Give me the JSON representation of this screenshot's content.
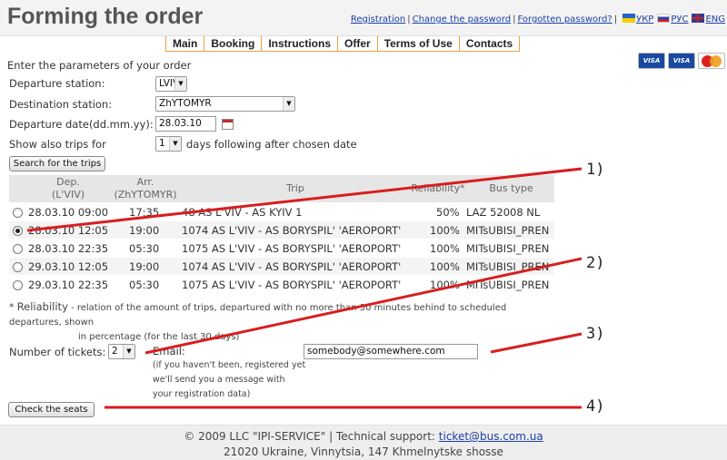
{
  "header": {
    "title": "Forming the order",
    "links": {
      "registration": "Registration",
      "change_password": "Change the password",
      "forgotten_password": "Forgotten password?",
      "sep": "|",
      "lang_ua": "УКР",
      "lang_ru": "РУС",
      "lang_en": "ENG"
    }
  },
  "nav": [
    "Main",
    "Booking",
    "Instructions",
    "Offer",
    "Terms of Use",
    "Contacts"
  ],
  "cards": {
    "visa": "VISA",
    "electron": "VISA",
    "mc": "MasterCard"
  },
  "form": {
    "heading": "Enter the parameters of your order",
    "departure_label": "Departure station:",
    "departure_value": "LVIV",
    "destination_label": "Destination station:",
    "destination_value": "ZhYTOMYR",
    "date_label": "Departure date(dd.mm.yy):",
    "date_value": "28.03.10",
    "show_label": "Show also trips for",
    "days_value": "1",
    "days_suffix": "days following after chosen date",
    "search_button": "Search for the trips"
  },
  "table": {
    "headers": {
      "dep": "Dep.",
      "dep_sub": "(L'VIV)",
      "arr": "Arr.",
      "arr_sub": "(ZhYTOMYR)",
      "trip": "Trip",
      "reliability": "Reliability*",
      "bus": "Bus type"
    },
    "rows": [
      {
        "dep": "28.03.10 09:00",
        "arr": "17:35",
        "trip": "48 AS L'VIV - AS KYIV 1",
        "rel": "50%",
        "bus": "LAZ 52008 NL",
        "selected": false
      },
      {
        "dep": "28.03.10 12:05",
        "arr": "19:00",
        "trip": "1074 AS L'VIV - AS BORYSPIL' 'AEROPORT'",
        "rel": "100%",
        "bus": "MITsUBISI_PREN",
        "selected": true
      },
      {
        "dep": "28.03.10 22:35",
        "arr": "05:30",
        "trip": "1075 AS L'VIV - AS BORYSPIL' 'AEROPORT'",
        "rel": "100%",
        "bus": "MITsUBISI_PREN",
        "selected": false
      },
      {
        "dep": "29.03.10 12:05",
        "arr": "19:00",
        "trip": "1074 AS L'VIV - AS BORYSPIL' 'AEROPORT'",
        "rel": "100%",
        "bus": "MITsUBISI_PREN",
        "selected": false
      },
      {
        "dep": "29.03.10 22:35",
        "arr": "05:30",
        "trip": "1075 AS L'VIV - AS BORYSPIL' 'AEROPORT'",
        "rel": "100%",
        "bus": "MITsUBISI_PREN",
        "selected": false
      }
    ]
  },
  "note": {
    "star": "*",
    "label": "Reliability",
    "text": "- relation of the amount of trips, departured with no more than 30 minutes behind to scheduled departures, shown",
    "text2": "in percentage (for the last 30 days)"
  },
  "tickets": {
    "label": "Number of tickets:",
    "value": "2",
    "email_label": "Email:",
    "email_value": "somebody@somewhere.com",
    "hint1": "(if you haven't been, registered yet",
    "hint2": "we'll send you a message with",
    "hint3": "your registration data)",
    "check_button": "Check the seats"
  },
  "callouts": [
    "1)",
    "2)",
    "3)",
    "4)"
  ],
  "footer": {
    "line1_prefix": "© 2009 LLC \"IPI-SERVICE\" | Technical support:",
    "email": "ticket@bus.com.ua",
    "line2": "21020 Ukraine, Vinnytsia, 147 Khmelnytske shosse"
  },
  "colors": {
    "annotation": "#d81e1e",
    "nav_border": "#f0a040",
    "link": "#1a3fa8"
  }
}
